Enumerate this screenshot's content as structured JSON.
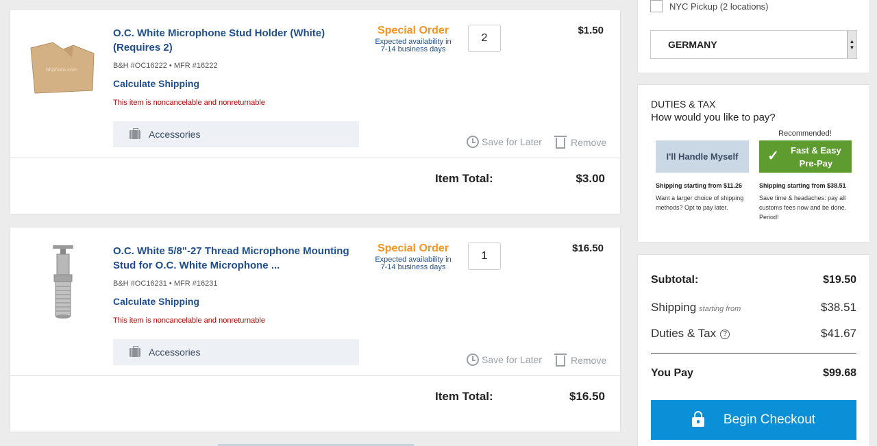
{
  "items": [
    {
      "title": "O.C. White Microphone Stud Holder (White) (Requires 2)",
      "sku": "B&H #OC16222 • MFR #16222",
      "calc_shipping": "Calculate Shipping",
      "notice": "This item is noncancelable and nonreturnable",
      "accessories": "Accessories",
      "status": "Special Order",
      "availability": "Expected availability in 7-14 business days",
      "qty": "2",
      "price": "$1.50",
      "save_for_later": "Save for Later",
      "remove": "Remove",
      "item_total_label": "Item Total:",
      "item_total": "$3.00",
      "image_watermark": "bhphoto.com"
    },
    {
      "title": "O.C. White 5/8\"-27 Thread Microphone Mounting Stud for O.C. White Microphone ...",
      "sku": "B&H #OC16231 • MFR #16231",
      "calc_shipping": "Calculate Shipping",
      "notice": "This item is noncancelable and nonreturnable",
      "accessories": "Accessories",
      "status": "Special Order",
      "availability": "Expected availability in 7-14 business days",
      "qty": "1",
      "price": "$16.50",
      "save_for_later": "Save for Later",
      "remove": "Remove",
      "item_total_label": "Item Total:",
      "item_total": "$16.50"
    }
  ],
  "shipping_panel": {
    "pickup_label": "NYC Pickup (2 locations)",
    "country": "GERMANY"
  },
  "duties_panel": {
    "heading": "DUTIES & TAX",
    "question": "How would you like to pay?",
    "recommended": "Recommended!",
    "option_self": "I'll Handle Myself",
    "option_prepay": "Fast & Easy Pre-Pay",
    "self_shipping": "Shipping starting from $11.26",
    "self_desc": "Want a larger choice of shipping methods? Opt to pay later.",
    "prepay_shipping": "Shipping starting from $38.51",
    "prepay_desc": "Save time & headaches: pay all customs fees now and be done. Period!"
  },
  "summary": {
    "subtotal_label": "Subtotal:",
    "subtotal": "$19.50",
    "shipping_label": "Shipping",
    "shipping_note": "starting from",
    "shipping": "$38.51",
    "duties_label": "Duties & Tax",
    "duties": "$41.67",
    "you_pay_label": "You Pay",
    "you_pay": "$99.68",
    "checkout": "Begin Checkout"
  },
  "colors": {
    "link_blue": "#1f4e8c",
    "special_order_orange": "#f7941d",
    "notice_red": "#b30000",
    "prepay_green": "#5e9c2f",
    "checkout_blue": "#0b8fd6"
  }
}
